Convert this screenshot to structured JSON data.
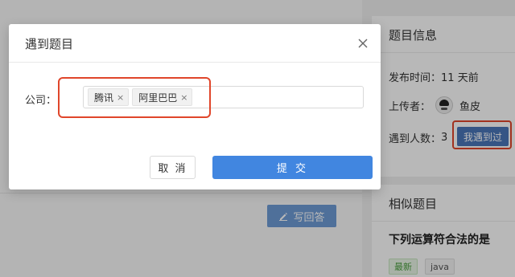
{
  "background": {
    "write_answer_label": "写回答"
  },
  "info_panel": {
    "title": "题目信息",
    "publish_label": "发布时间：",
    "publish_value": "11 天前",
    "uploader_label": "上传者：",
    "uploader_name": "鱼皮",
    "met_count_label": "遇到人数：",
    "met_count_value": "3",
    "met_button_label": "我遇到过"
  },
  "similar_panel": {
    "title": "相似题目",
    "item_title": "下列运算符合法的是",
    "tags": [
      "最新",
      "java"
    ]
  },
  "modal": {
    "title": "遇到题目",
    "company_label": "公司：",
    "companies": [
      "腾讯",
      "阿里巴巴"
    ],
    "cancel_label": "取 消",
    "submit_label": "提 交"
  },
  "colors": {
    "primary": "#4186e0",
    "highlight_red": "#e0462b",
    "met_button": "#4a76b9"
  }
}
